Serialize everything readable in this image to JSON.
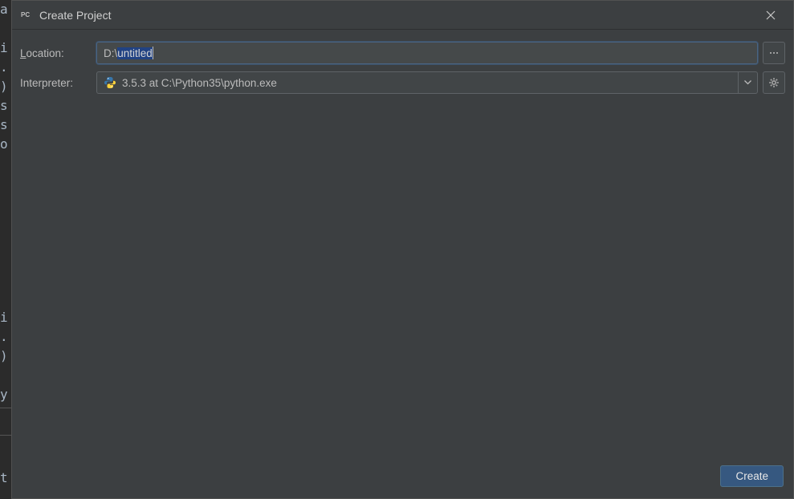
{
  "bgGutter": [
    "a",
    "",
    "i",
    ".",
    ")",
    "s",
    "s",
    "o",
    "",
    "",
    "",
    "",
    "",
    "",
    "",
    "",
    "i",
    ".",
    ")",
    "",
    "y",
    "=",
    "—",
    "",
    "t"
  ],
  "dialog": {
    "title": "Create Project",
    "appIconLabel": "PC"
  },
  "form": {
    "location_label_prefix": "L",
    "location_label_rest": "ocation:",
    "location_prefix": "D:\\",
    "location_selected": "untitled",
    "interpreter_label": "Interpreter:",
    "interpreter_value": "3.5.3 at C:\\Python35\\python.exe",
    "browse_tooltip": "...",
    "gear_tooltip": "Settings"
  },
  "footer": {
    "create_label": "Create"
  }
}
